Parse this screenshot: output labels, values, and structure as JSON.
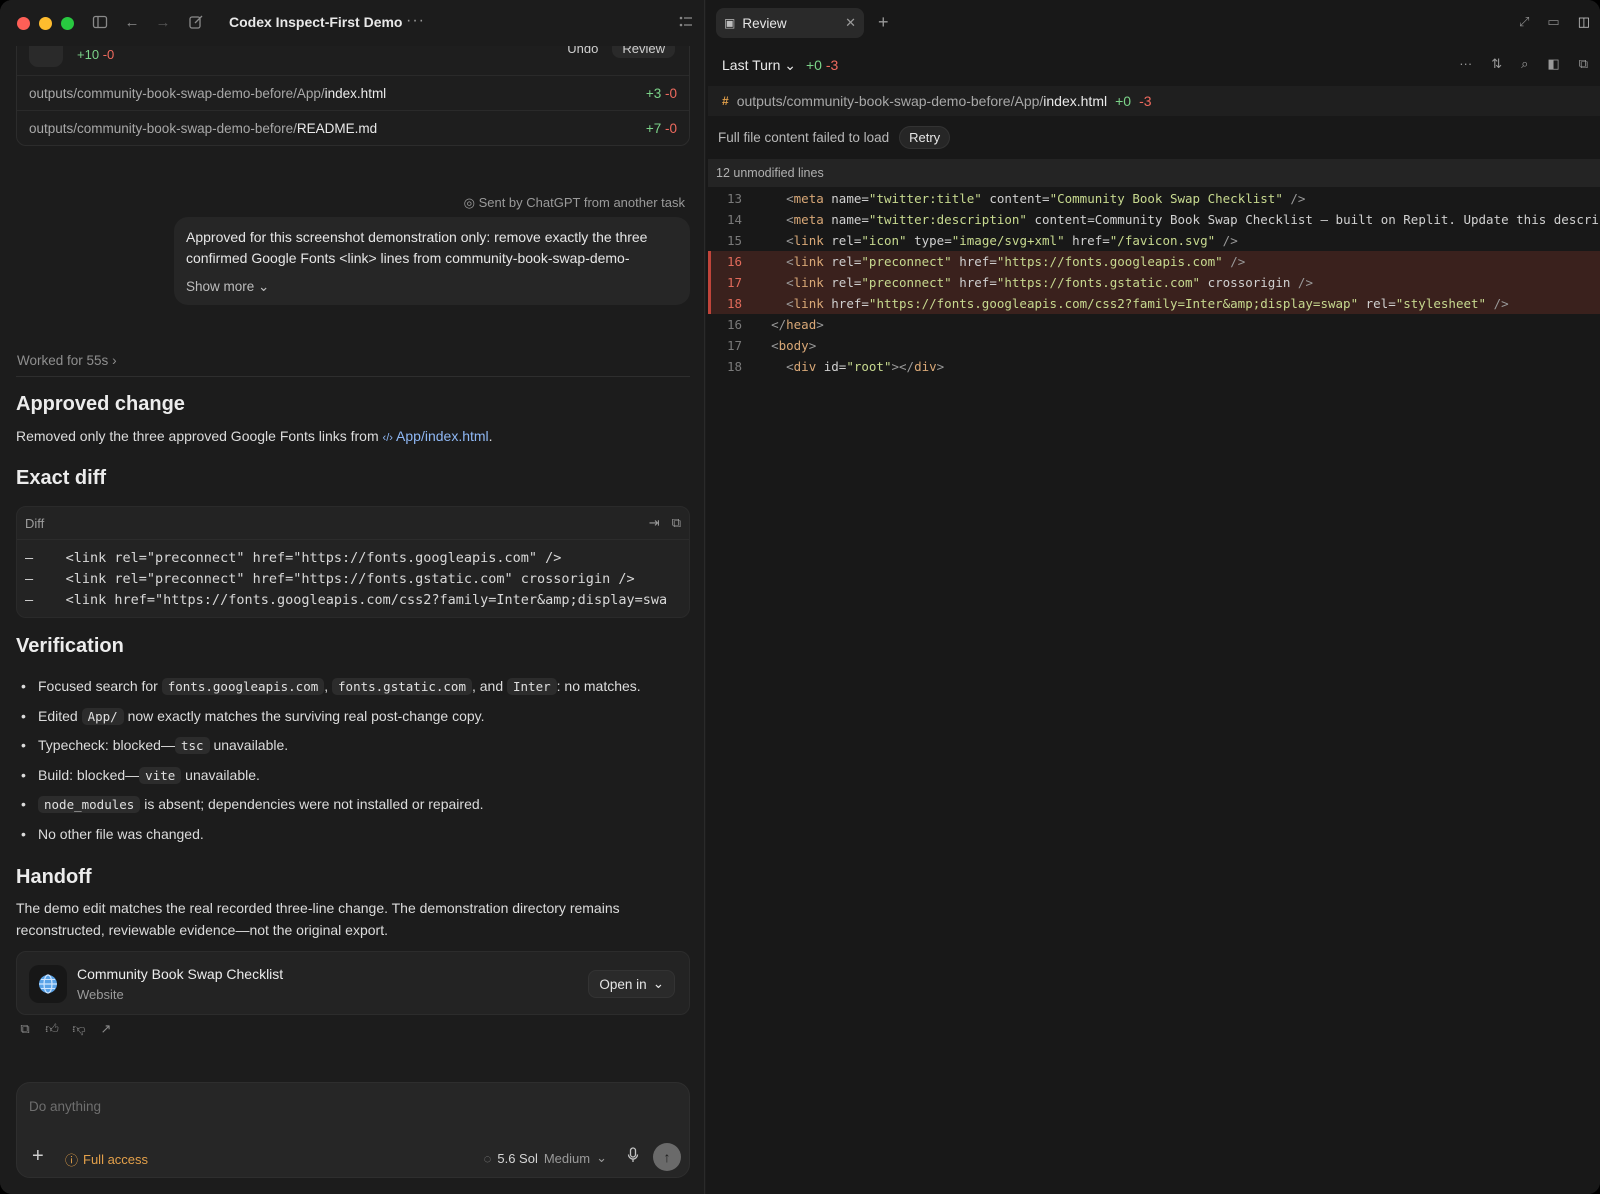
{
  "window": {
    "title": "Codex Inspect-First Demo"
  },
  "changes_card": {
    "header_stats_plus": "+10",
    "header_stats_minus": "-0",
    "undo_label": "Undo",
    "review_label": "Review",
    "files": [
      {
        "path": "outputs/community-book-swap-demo-before/App/",
        "name": "index.html",
        "plus": "+3",
        "minus": "-0"
      },
      {
        "path": "outputs/community-book-swap-demo-before/",
        "name": "README.md",
        "plus": "+7",
        "minus": "-0"
      }
    ]
  },
  "message": {
    "sent_by": "Sent by ChatGPT from another task",
    "text": "Approved for this screenshot demonstration only: remove exactly the three confirmed Google Fonts <link> lines from community-book-swap-demo-",
    "show_more": "Show more"
  },
  "worked_for": "Worked for 55s",
  "approved": {
    "heading": "Approved change",
    "text": "Removed only the three approved Google Fonts links from",
    "link": "App/index.html",
    "period": "."
  },
  "exact_diff": {
    "heading": "Exact diff",
    "box_label": "Diff",
    "lines": [
      "–    <link rel=\"preconnect\" href=\"https://fonts.googleapis.com\" />",
      "–    <link rel=\"preconnect\" href=\"https://fonts.gstatic.com\" crossorigin />",
      "–    <link href=\"https://fonts.googleapis.com/css2?family=Inter&amp;display=swa"
    ]
  },
  "verification": {
    "heading": "Verification",
    "item1": {
      "prefix": "Focused search for",
      "code1": "fonts.googleapis.com",
      "sep": ",",
      "code2": "fonts.gstatic.com",
      "and": ", and",
      "code3": "Inter",
      "suffix": ": no matches."
    },
    "item2": {
      "prefix": "Edited",
      "code": "App/",
      "suffix": "now exactly matches the surviving real post-change copy."
    },
    "item3": {
      "prefix": "Typecheck: blocked—",
      "code": "tsc",
      "suffix": "unavailable."
    },
    "item4": {
      "prefix": "Build: blocked—",
      "code": "vite",
      "suffix": "unavailable."
    },
    "item5": {
      "code": "node_modules",
      "suffix": "is absent; dependencies were not installed or repaired."
    },
    "item6": {
      "text": "No other file was changed."
    }
  },
  "handoff": {
    "heading": "Handoff",
    "text": "The demo edit matches the real recorded three-line change. The demonstration directory remains reconstructed, reviewable evidence—not the original export."
  },
  "app_card": {
    "title": "Community Book Swap Checklist",
    "subtitle": "Website",
    "open_label": "Open in"
  },
  "composer": {
    "placeholder": "Do anything",
    "access_label": "Full access",
    "model_label": "5.6 Sol",
    "model_level": "Medium"
  },
  "review": {
    "tab_label": "Review",
    "turn_label": "Last Turn",
    "turn_plus": "+0",
    "turn_minus": "-3",
    "file_path": "outputs/community-book-swap-demo-before/App/",
    "file_name": "index.html",
    "file_plus": "+0",
    "file_minus": "-3",
    "notice": "Full file content failed to load",
    "retry_label": "Retry",
    "unmodified": "12 unmodified lines",
    "lines": [
      {
        "num": "13",
        "type": "ctx",
        "text": "    <meta name=\"twitter:title\" content=\"Community Book Swap Checklist\" />"
      },
      {
        "num": "14",
        "type": "ctx",
        "text": "    <meta name=\"twitter:description\" content=\"Community Book Swap Checklist — built on Replit. Update this descripti"
      },
      {
        "num": "15",
        "type": "ctx",
        "text": "    <link rel=\"icon\" type=\"image/svg+xml\" href=\"/favicon.svg\" />"
      },
      {
        "num": "16",
        "type": "del",
        "text": "    <link rel=\"preconnect\" href=\"https://fonts.googleapis.com\" />"
      },
      {
        "num": "17",
        "type": "del",
        "text": "    <link rel=\"preconnect\" href=\"https://fonts.gstatic.com\" crossorigin />"
      },
      {
        "num": "18",
        "type": "del",
        "text": "    <link href=\"https://fonts.googleapis.com/css2?family=Inter&amp;display=swap\" rel=\"stylesheet\" />"
      },
      {
        "num": "16",
        "type": "ctx",
        "text": "  </head>"
      },
      {
        "num": "17",
        "type": "ctx",
        "text": "  <body>"
      },
      {
        "num": "18",
        "type": "ctx",
        "text": "    <div id=\"root\"></div>"
      }
    ]
  },
  "colors": {
    "plus": "#7bd389",
    "minus": "#ef6a5e",
    "accent_warning": "#e3a04a",
    "link": "#8fb8f5"
  }
}
